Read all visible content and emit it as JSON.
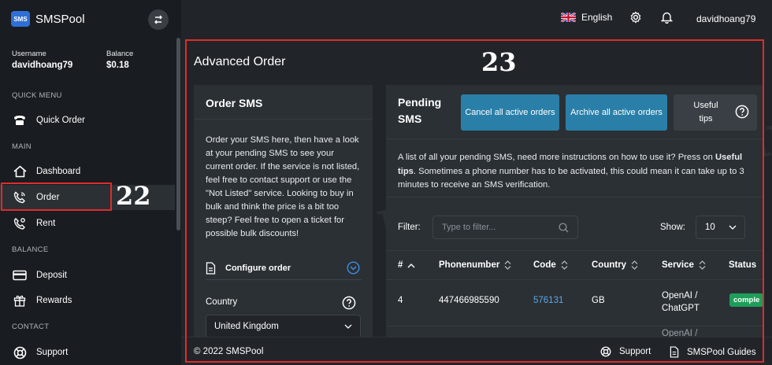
{
  "brand": {
    "logo_text": "SMS",
    "name": "SMSPool"
  },
  "user": {
    "username_label": "Username",
    "username": "davidhoang79",
    "balance_label": "Balance",
    "balance": "$0.18"
  },
  "sidebar": {
    "sections": [
      "QUICK MENU",
      "MAIN",
      "BALANCE",
      "CONTACT"
    ],
    "items": [
      {
        "label": "Quick Order",
        "icon": "phone-icon"
      },
      {
        "label": "Dashboard",
        "icon": "home-icon"
      },
      {
        "label": "Order",
        "icon": "phone-call-icon",
        "active": true
      },
      {
        "label": "Rent",
        "icon": "phone-location-icon"
      },
      {
        "label": "Deposit",
        "icon": "card-icon"
      },
      {
        "label": "Rewards",
        "icon": "gift-icon"
      },
      {
        "label": "Support",
        "icon": "lifebuoy-icon"
      }
    ]
  },
  "topbar": {
    "language": "English",
    "username": "davidhoang79"
  },
  "annotations": {
    "order": "22",
    "main": "23"
  },
  "main": {
    "title": "Advanced Order",
    "order_card": {
      "title": "Order SMS",
      "text": "Order your SMS here, then have a look at your pending SMS to see your current order. If the service is not listed, feel free to contact support or use the \"Not Listed\" service. Looking to buy in bulk and think the price is a bit too steep? Feel free to open a ticket for possible bulk discounts!",
      "configure_label": "Configure order",
      "country_label": "Country",
      "country_value": "United Kingdom"
    },
    "pending_card": {
      "title": "Pending SMS",
      "cancel_btn": "Cancel all active orders",
      "archive_btn": "Archive all active orders",
      "tips_btn": "Useful tips",
      "info_before": "A list of all your pending SMS, need more instructions on how to use it? Press on ",
      "info_bold": "Useful tips",
      "info_after": ". Sometimes a phone number has to be activated, this could mean it can take up to 3 minutes to receive an SMS verification.",
      "filter_label": "Filter:",
      "filter_placeholder": "Type to filter...",
      "show_label": "Show:",
      "show_value": "10",
      "columns": [
        "#",
        "Phonenumber",
        "Code",
        "Country",
        "Service",
        "Status"
      ],
      "rows": [
        {
          "id": "4",
          "phone": "447466985590",
          "code": "576131",
          "country": "GB",
          "service": "OpenAI / ChatGPT",
          "status": "comple"
        }
      ],
      "next_row_faint": "OpenAI /"
    }
  },
  "footer": {
    "copyright": "© 2022 SMSPool",
    "support": "Support",
    "guides": "SMSPool Guides"
  },
  "colors": {
    "accent_blue": "#2a7fa8",
    "annotation_red": "#e12b2b",
    "status_green": "#1e9e5a",
    "link": "#5aa9e6"
  }
}
